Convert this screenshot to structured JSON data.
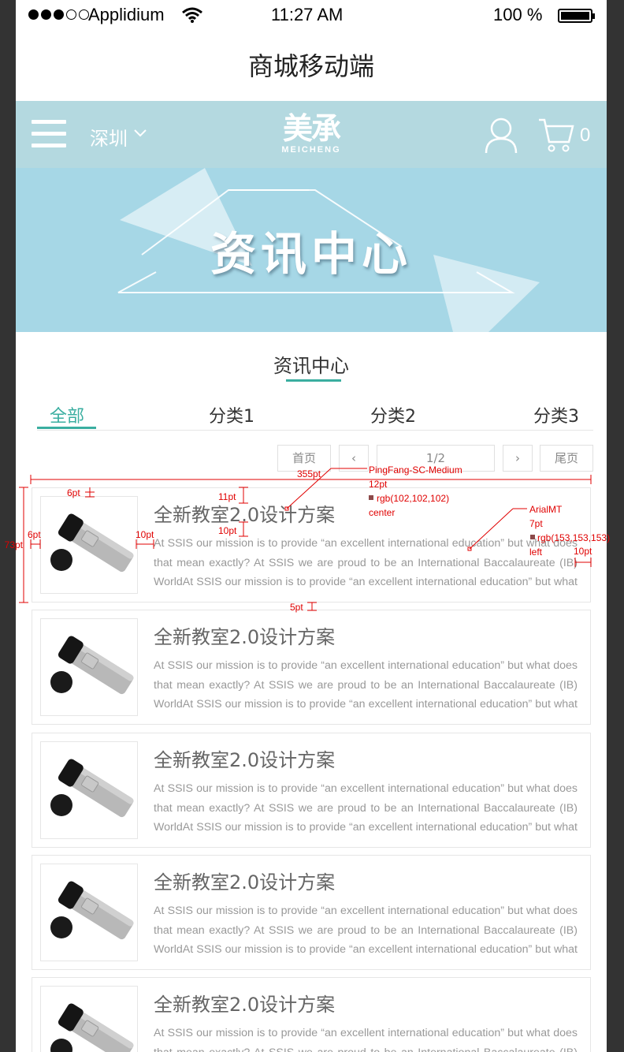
{
  "status": {
    "carrier": "Applidium",
    "time": "11:27 AM",
    "battery": "100 %"
  },
  "page_title": "商城移动端",
  "header": {
    "city": "深圳",
    "logo_cn": "美承",
    "logo_en": "MEICHENG",
    "cart_count": "0"
  },
  "banner": {
    "text": "资讯中心"
  },
  "section": {
    "title": "资讯中心"
  },
  "tabs": [
    {
      "label": "全部"
    },
    {
      "label": "分类1"
    },
    {
      "label": "分类2"
    },
    {
      "label": "分类3"
    }
  ],
  "pager": {
    "first": "首页",
    "prev": "‹",
    "page": "1/2",
    "next": "›",
    "last": "尾页"
  },
  "items": [
    {
      "title": "全新教室2.0设计方案",
      "desc": "At SSIS our mission is to provide “an excellent international education” but what does that mean exactly? At SSIS we are proud to be an International Baccalaureate (IB) WorldAt SSIS our mission is to provide “an excellent international education” but what does"
    },
    {
      "title": "全新教室2.0设计方案",
      "desc": "At SSIS our mission is to provide “an excellent international education” but what does that mean exactly? At SSIS we are proud to be an International Baccalaureate (IB) WorldAt SSIS our mission is to provide “an excellent international education” but what does"
    },
    {
      "title": "全新教室2.0设计方案",
      "desc": "At SSIS our mission is to provide “an excellent international education” but what does that mean exactly? At SSIS we are proud to be an International Baccalaureate (IB) WorldAt SSIS our mission is to provide “an excellent international education” but what does"
    },
    {
      "title": "全新教室2.0设计方案",
      "desc": "At SSIS our mission is to provide “an excellent international education” but what does that mean exactly? At SSIS we are proud to be an International Baccalaureate (IB) WorldAt SSIS our mission is to provide “an excellent international education” but what does"
    },
    {
      "title": "全新教室2.0设计方案",
      "desc": "At SSIS our mission is to provide “an excellent international education” but what does that mean exactly? At SSIS we are proud to be an International Baccalaureate (IB) WorldAt SSIS our mission is to provide “an excellent international education” but what does"
    }
  ],
  "annotations": {
    "w355": "355pt",
    "font_title": "PingFang-SC-Medium",
    "size12": "12pt",
    "color_title": "rgb(102,102,102)",
    "align_center": "center",
    "font_desc": "ArialMT",
    "size7": "7pt",
    "color_desc": "rgb(153,153,153)",
    "align_left": "left",
    "gap6a": "6pt",
    "gap11": "11pt",
    "gap10a": "10pt",
    "gap6b": "6pt",
    "gap10b": "10pt",
    "h73": "73pt",
    "gap10c": "10pt",
    "gap5": "5pt"
  },
  "colors": {
    "accent": "#3aaea0",
    "header_bg": "#b4d9e0",
    "banner_bg": "#a6d7e6",
    "title_text": "#666666",
    "desc_text": "#999999",
    "annotation": "#e00000"
  }
}
